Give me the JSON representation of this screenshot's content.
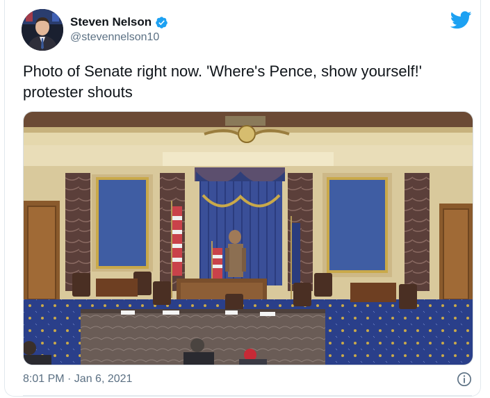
{
  "author": {
    "name": "Steven Nelson",
    "handle": "@stevennelson10",
    "verified_icon": "verified-badge-icon",
    "avatar": "profile-photo"
  },
  "tweet": {
    "text": "Photo of Senate right now. 'Where's Pence, show yourself!' protester shouts",
    "photo": "senate-chamber-photo"
  },
  "footer": {
    "timestamp": "8:01 PM · Jan 6, 2021",
    "info_icon": "info-icon"
  },
  "brand": {
    "logo": "twitter-bird-icon",
    "accent": "#1da1f2"
  },
  "colors": {
    "text": "#0f1419",
    "secondary": "#5b7083"
  }
}
